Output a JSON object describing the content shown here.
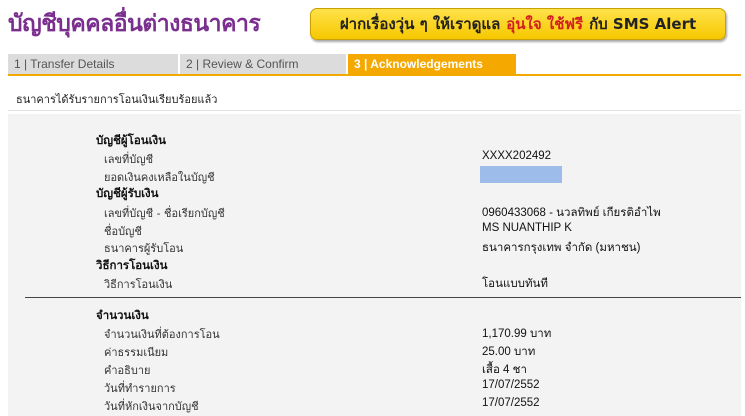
{
  "header": {
    "title": "บัญชีบุคคลอื่นต่างธนาคาร",
    "banner": {
      "part1": "ฝากเรื่องวุ่น ๆ ให้เราดูแล",
      "part2": "อุ่นใจ ใช้ฟรี",
      "part3": "กับ SMS Alert"
    }
  },
  "tabs": [
    {
      "label": "1 | Transfer Details"
    },
    {
      "label": "2 | Review & Confirm"
    },
    {
      "label": "3 | Acknowledgements"
    }
  ],
  "message": "ธนาคารได้รับรายการโอนเงินเรียบร้อยแล้ว",
  "from_account": {
    "heading": "บัญชีผู้โอนเงิน",
    "number_label": "เลขที่บัญชี",
    "number_value": "XXXX202492",
    "balance_label": "ยอดเงินคงเหลือในบัญชี"
  },
  "to_account": {
    "heading": "บัญชีผู้รับเงิน",
    "number_label": "เลขที่บัญชี - ชื่อเรียกบัญชี",
    "number_value": "0960433068 - นวลทิพย์ เกียรติอำไพ",
    "name_label": "ชื่อบัญชี",
    "name_value": "MS NUANTHIP K",
    "bank_label": "ธนาคารผู้รับโอน",
    "bank_value": "ธนาคารกรุงเทพ จำกัด (มหาชน)"
  },
  "method": {
    "heading": "วิธีการโอนเงิน",
    "label": "วิธีการโอนเงิน",
    "value": "โอนแบบทันที"
  },
  "amount": {
    "heading": "จำนวนเงิน",
    "amount_label": "จำนวนเงินที่ต้องการโอน",
    "amount_value": "1,170.99 บาท",
    "fee_label": "ค่าธรรมเนียม",
    "fee_value": "25.00  บาท",
    "desc_label": "คำอธิบาย",
    "desc_value": "เสื้อ 4 ชา",
    "txn_date_label": "วันที่ทำรายการ",
    "txn_date_value": "17/07/2552",
    "debit_date_label": "วันที่หักเงินจากบัญชี",
    "debit_date_value": "17/07/2552"
  },
  "colors": {
    "title": "#7a2e8e",
    "active_tab": "#f5a800",
    "banner": "#ffe24a",
    "masked": "#9dbcea"
  }
}
